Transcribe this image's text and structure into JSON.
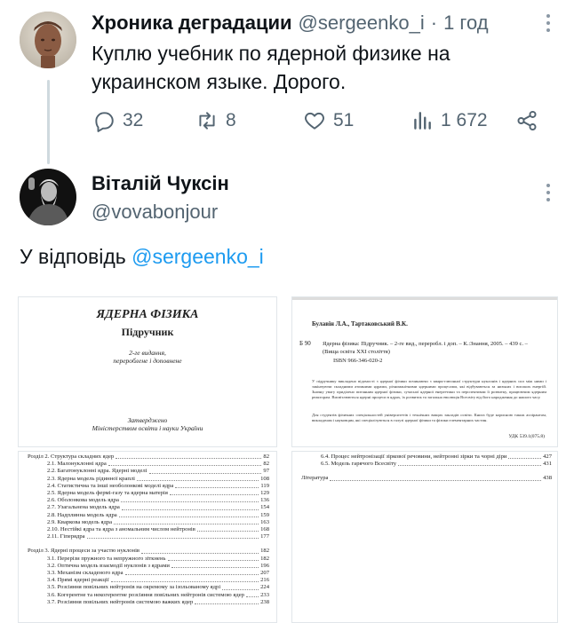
{
  "tweet": {
    "author_name": "Хроника деградации",
    "author_handle": "@sergeenko_i",
    "separator": "·",
    "time": "1 год",
    "text_line1": "Куплю учебник по ядерной физике на",
    "text_line2": "украинском языке. Дорого.",
    "actions": {
      "replies": "32",
      "retweets": "8",
      "likes": "51",
      "views": "1 672"
    }
  },
  "reply": {
    "author_name": "Віталій Чуксін",
    "author_handle": "@vovabonjour",
    "reply_prefix": "У відповідь",
    "reply_mention": "@sergeenko_i"
  },
  "book": {
    "title": "ЯДЕРНА ФІЗИКА",
    "subtitle": "Підручник",
    "edition1": "2-ге видання,",
    "edition2": "перероблене і доповнене",
    "approved1": "Затверджено",
    "approved2": "Міністерством освіти і науки України",
    "authors": "Булавін Л.А., Тартаковський В.К.",
    "code": "Б 90",
    "citation": "Ядерна фізика: Підручник. – 2-ге вид., переробл. і доп. – К.:Знання, 2005. – 439 с. – (Вища освіта XXI століття)",
    "isbn": "ISBN 966-346-020-2",
    "annotation": "У підручнику викладено відомості з ядерної фізики починаючи з кварк-глюонної структури нуклонів і ядерних сил між ними і закінчуючи складними атомними ядрами, різноманітними ядерними процесами, які відбуваються за низьких і високих енергій. Значну увагу приділено питанням ядерної фізики, сучасної ядерної енергетики та перспективам її розвитку, працюючим ядерним реакторам. Висвітлюються ядерні процеси в ядрах, їх розвиток та загальна еволюція Всесвіту від його народження до нашого часу.",
    "annotation2": "Для студентів фізичних спеціальностей університетів і технічних вищих закладів освіти. Книга буде корисною також аспірантам, викладачам і науковцям, які спеціалізуються в галузі ядерної фізики та фізики елементарних частин.",
    "udk": "УДК 539.1(075.8)",
    "toc_left": [
      {
        "t": "Розділ 2. Структура складних ядер",
        "p": "82"
      },
      {
        "t": "2.1. Малонуклонні ядра",
        "p": "82"
      },
      {
        "t": "2.2. Багатонуклонні ядра. Ядерні моделі",
        "p": "97"
      },
      {
        "t": "2.3. Ядерна модель рідинної краплі",
        "p": "108"
      },
      {
        "t": "2.4. Статистична та інші необолонкові моделі ядра",
        "p": "119"
      },
      {
        "t": "2.5. Ядерна модель фермі-газу та ядерна матерія",
        "p": "129"
      },
      {
        "t": "2.6. Оболонкова модель ядра",
        "p": "136"
      },
      {
        "t": "2.7. Узагальнена модель ядра",
        "p": "154"
      },
      {
        "t": "2.8. Надплинна модель ядра",
        "p": "159"
      },
      {
        "t": "2.9. Кваркова модель ядра",
        "p": "163"
      },
      {
        "t": "2.10. Нестійкі ядра та ядра з аномальним числом нейтронів",
        "p": "168"
      },
      {
        "t": "2.11. Гіперядра",
        "p": "177"
      },
      {
        "t": "",
        "p": ""
      },
      {
        "t": "Розділ 3. Ядерні процеси за участю нуклонів",
        "p": "182"
      },
      {
        "t": "3.1. Перерізи пружного та непружного зіткнень",
        "p": "182"
      },
      {
        "t": "3.2. Оптична модель взаємодії нуклонів з ядрами",
        "p": "196"
      },
      {
        "t": "3.3. Механізм складеного ядра",
        "p": "207"
      },
      {
        "t": "3.4. Прямі ядерні реакції",
        "p": "216"
      },
      {
        "t": "3.5. Розсіяння повільних нейтронів на окремому за ізольованому ядрі",
        "p": "224"
      },
      {
        "t": "3.6. Когерентне та некогерентне розсіяння повільних нейтронів системою ядер",
        "p": "233"
      },
      {
        "t": "3.7. Розсіяння повільних нейтронів системою важких ядер",
        "p": "238"
      }
    ],
    "toc_right": [
      {
        "t": "6.4. Процес нейтронізації зіркової речовини, нейтронні зірки та чорні діри",
        "p": "427"
      },
      {
        "t": "6.5. Модель гарячого Всесвіту",
        "p": "431"
      },
      {
        "t": "",
        "p": ""
      },
      {
        "t": "Література",
        "p": "438"
      }
    ]
  },
  "colors": {
    "link": "#1d9bf0",
    "secondary_text": "#536471",
    "thread_line": "#cfd9de"
  },
  "icons": [
    "reply-icon",
    "retweet-icon",
    "like-icon",
    "views-icon",
    "share-icon",
    "more-icon"
  ]
}
